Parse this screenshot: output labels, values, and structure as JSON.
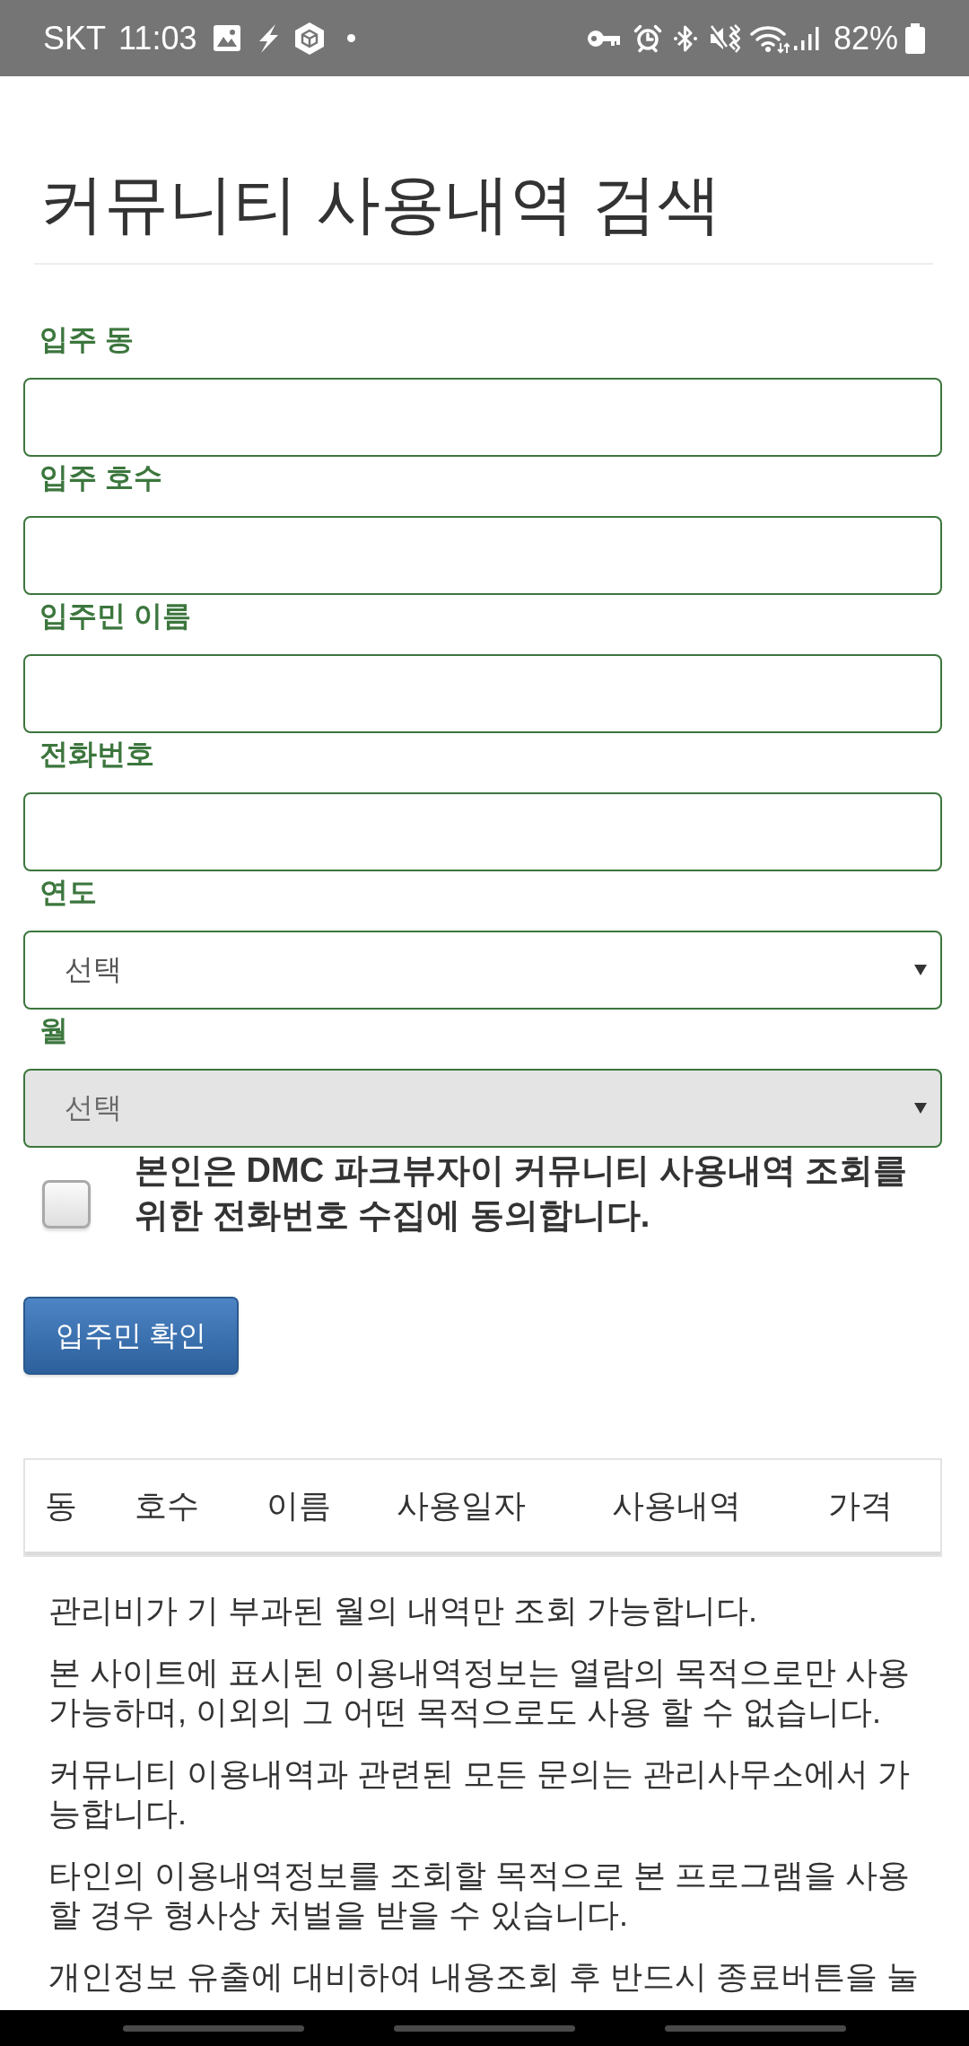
{
  "status_bar": {
    "carrier": "SKT",
    "time": "11:03",
    "battery": "82%"
  },
  "page": {
    "title": "커뮤니티 사용내역 검색"
  },
  "form": {
    "fields": [
      {
        "kind": "input",
        "label": "입주 동",
        "disabled": false
      },
      {
        "kind": "input",
        "label": "입주 호수",
        "disabled": false
      },
      {
        "kind": "input",
        "label": "입주민 이름",
        "disabled": false
      },
      {
        "kind": "input",
        "label": "전화번호",
        "disabled": false
      },
      {
        "kind": "select",
        "label": "연도",
        "value": "선택",
        "disabled": false
      },
      {
        "kind": "select",
        "label": "월",
        "value": "선택",
        "disabled": true
      }
    ],
    "consent": {
      "checked": false,
      "text": "본인은 DMC 파크뷰자이 커뮤니티 사용내역 조회를 위한 전화번호 수집에 동의합니다."
    },
    "submit_button": {
      "label": "입주민 확인"
    }
  },
  "table": {
    "columns": [
      "동",
      "호수",
      "이름",
      "사용일자",
      "사용내역",
      "가격"
    ]
  },
  "notices": [
    "관리비가 기 부과된 월의 내역만 조회 가능합니다.",
    "본 사이트에 표시된 이용내역정보는 열람의 목적으로만 사용 가능하며, 이외의 그 어떤 목적으로도 사용 할 수 없습니다.",
    "커뮤니티 이용내역과 관련된 모든 문의는 관리사무소에서 가능합니다.",
    "타인의 이용내역정보를 조회할 목적으로 본 프로그램을 사용할 경우 형사상 처벌을 받을 수 있습니다.",
    "개인정보 유출에 대비하여 내용조회 후 반드시 종료버튼을 눌"
  ]
}
